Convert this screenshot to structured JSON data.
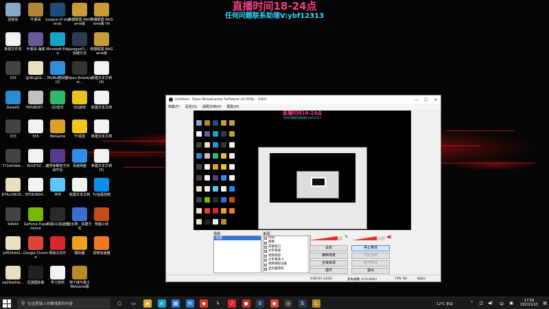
{
  "overlay": {
    "line1": "直播时间18-24点",
    "line2": "任何问题联系助理V:ybf12313"
  },
  "desktop_icons": [
    {
      "label": "回收站",
      "icon": "recycle-bin-icon",
      "color": "#8aa6c9"
    },
    {
      "label": "叶晨哥",
      "icon": "folder-icon",
      "color": "#b0863a"
    },
    {
      "label": "League of Legends",
      "icon": "league-of-legends-icon",
      "color": "#1f4d7a"
    },
    {
      "label": "英雄联盟 WeGame版",
      "icon": "lol-wegame-icon",
      "color": "#c99c3a"
    },
    {
      "label": "英雄联盟 WeGame版 (4)",
      "icon": "lol-wegame-icon",
      "color": "#c99c3a"
    },
    {
      "label": "新建文件夹",
      "icon": "file-icon",
      "color": "#f2f2f2"
    },
    {
      "label": "叶晨哥-海底",
      "icon": "folder-icon",
      "color": "#6a5a9a"
    },
    {
      "label": "Microsoft Edge",
      "icon": "edge-icon",
      "color": "#1aa3c9"
    },
    {
      "label": "LeagueCl... - 快捷方式",
      "icon": "league-client-icon",
      "color": "#2b3a55"
    },
    {
      "label": "英雄联盟 WeGame版",
      "icon": "lol-wegame-icon",
      "color": "#c99c3a"
    },
    {
      "label": "333",
      "icon": "app-icon",
      "color": "#444"
    },
    {
      "label": "@WL@GL...",
      "icon": "doc-icon",
      "color": "#e8e0c0"
    },
    {
      "label": "MuMu模拟器 (2)",
      "icon": "mumu-icon",
      "color": "#2f8fd8"
    },
    {
      "label": "Open Broadcast...",
      "icon": "obs-icon",
      "color": "#333"
    },
    {
      "label": "新建文本文档 (4)",
      "icon": "text-file-icon",
      "color": "#f2f2f2"
    },
    {
      "label": "DetailQ",
      "icon": "globe-icon",
      "color": "#2a8bd0"
    },
    {
      "label": "7N%BO97...",
      "icon": "file-icon",
      "color": "#c0c0c0"
    },
    {
      "label": "QQ音乐",
      "icon": "qq-music-icon",
      "color": "#2fb86b"
    },
    {
      "label": "QQ游戏",
      "icon": "qq-game-icon",
      "color": "#e9c31f"
    },
    {
      "label": "新建文本文档",
      "icon": "text-file-icon",
      "color": "#f2f2f2"
    },
    {
      "label": "333",
      "icon": "app-icon",
      "color": "#444"
    },
    {
      "label": "555",
      "icon": "file-icon",
      "color": "#f2f2f2"
    },
    {
      "label": "WeGame",
      "icon": "wegame-icon",
      "color": "#d9a227"
    },
    {
      "label": "YY语音",
      "icon": "yy-icon",
      "color": "#f4c51c"
    },
    {
      "label": "新建文本文档",
      "icon": "text-file-icon",
      "color": "#f2f2f2"
    },
    {
      "label": "771afcbbe...",
      "icon": "app-icon",
      "color": "#444"
    },
    {
      "label": "AUUFXZ...",
      "icon": "file-icon",
      "color": "#f2f2f2"
    },
    {
      "label": "魔界争霸官方对战平台",
      "icon": "game-platform-icon",
      "color": "#5a3a8a"
    },
    {
      "label": "百度网盘",
      "icon": "baidu-netdisk-icon",
      "color": "#2f8fe8"
    },
    {
      "label": "新建文本文档 (5)",
      "icon": "text-file-icon",
      "color": "#f2f2f2"
    },
    {
      "label": "874c29635...",
      "icon": "doc-icon",
      "color": "#e8e0c0"
    },
    {
      "label": "EFDE3604...",
      "icon": "file-icon",
      "color": "#f2f2f2"
    },
    {
      "label": "伴伴",
      "icon": "banban-icon",
      "color": "#5ac8fa"
    },
    {
      "label": "新建文本文档",
      "icon": "text-file-icon",
      "color": "#f2f2f2"
    },
    {
      "label": "TV远程控制",
      "icon": "teamviewer-icon",
      "color": "#0e8ee9"
    },
    {
      "label": "44444",
      "icon": "app-icon",
      "color": "#444"
    },
    {
      "label": "GeForce Experience",
      "icon": "geforce-icon",
      "color": "#76b900"
    },
    {
      "label": "网易UU加速器",
      "icon": "uu-icon",
      "color": "#2a2a2a"
    },
    {
      "label": "逆水寒 - 快捷方式",
      "icon": "game-icon",
      "color": "#3a6fd0"
    },
    {
      "label": "穿越火线",
      "icon": "crossfire-icon",
      "color": "#c44a1a"
    },
    {
      "label": "a3634dd2...",
      "icon": "doc-icon",
      "color": "#e8e0c0"
    },
    {
      "label": "Google Chrome",
      "icon": "chrome-icon",
      "color": "#db4437"
    },
    {
      "label": "网易云音乐",
      "icon": "netease-music-icon",
      "color": "#d8262a"
    },
    {
      "label": "模拟器",
      "icon": "emulator-icon",
      "color": "#f0a020"
    },
    {
      "label": "雷神加速器",
      "icon": "thunder-accelerator-icon",
      "color": "#f07a20"
    },
    {
      "label": "ea29aefde...",
      "icon": "doc-icon",
      "color": "#e8e0c0"
    },
    {
      "label": "迅游国际版",
      "icon": "xunyou-icon",
      "color": "#222"
    },
    {
      "label": "学习资料",
      "icon": "file-icon",
      "color": "#f2f2f2"
    },
    {
      "label": "地下城与勇士 WeGame版",
      "icon": "dnf-icon",
      "color": "#b58a2a"
    }
  ],
  "obs": {
    "title": "Untitled - Open Broadcaster Software v0.659b - 32bit",
    "menu": [
      "档案(F)",
      "设定(S)",
      "说明文档(H)",
      "帮助(H)"
    ],
    "preview_banner_1": "直播时间18-24点",
    "preview_banner_2": "任何问题联系助理V:ybf12313",
    "scenes_label": "场景:",
    "scene_selected": "场景",
    "sources_label": "来源:",
    "sources": [
      {
        "name": "时间",
        "checked": false
      },
      {
        "name": "图像",
        "checked": true
      },
      {
        "name": "获取窗口",
        "checked": false
      },
      {
        "name": "文字来源",
        "checked": true
      },
      {
        "name": "视频视窗",
        "checked": false
      },
      {
        "name": "文字来源 5",
        "checked": false
      },
      {
        "name": "视频捕捉设备",
        "checked": false
      },
      {
        "name": "显示器获取",
        "checked": true
      }
    ],
    "buttons": {
      "settings": "设定",
      "stop_stream": "停止推流",
      "edit_scene": "编辑场景",
      "start_record": "开始录制",
      "global_sources": "全域来源",
      "pause": "暂停推流",
      "plugins": "插件",
      "exit": "退出"
    },
    "audio": {
      "desktop_level": 0.85,
      "mic_level": 0.75
    },
    "status": {
      "time": "0:00:01 (LIVE)",
      "dropped": "丢失帧数: 0 (0.00%)",
      "fps": "FPS: 60",
      "bitrate": "0kb/s"
    }
  },
  "taskbar": {
    "search_placeholder": "在这里输入你要搜索的内容",
    "pinned": [
      {
        "icon": "cortana-icon",
        "color": "#1b1b1b",
        "glyph": "○",
        "active": false
      },
      {
        "icon": "task-view-icon",
        "color": "#1b1b1b",
        "glyph": "▭",
        "active": false
      },
      {
        "icon": "file-explorer-icon",
        "color": "#e0b030",
        "glyph": "▰",
        "active": false
      },
      {
        "icon": "edge-icon",
        "color": "#1aa3c9",
        "glyph": "e",
        "active": false
      },
      {
        "icon": "store-icon",
        "color": "#2a7bd8",
        "glyph": "▦",
        "active": false
      },
      {
        "icon": "mail-icon",
        "color": "#2a7bd8",
        "glyph": "✉",
        "active": false
      },
      {
        "icon": "app-red-icon",
        "color": "#d83a2a",
        "glyph": "◆",
        "active": false
      },
      {
        "icon": "lightning-icon",
        "color": "#1b1b1b",
        "glyph": "ϟ",
        "active": false
      },
      {
        "icon": "netease-music-icon",
        "color": "#d8262a",
        "glyph": "♪",
        "active": false
      },
      {
        "icon": "app-icon",
        "color": "#c83030",
        "glyph": "●",
        "active": false
      },
      {
        "icon": "steam-icon",
        "color": "#2a3a55",
        "glyph": "S",
        "active": false
      },
      {
        "icon": "chrome-icon",
        "color": "#db4437",
        "glyph": "◉",
        "active": true
      },
      {
        "icon": "obs-icon",
        "color": "#333",
        "glyph": "◎",
        "active": true
      },
      {
        "icon": "steam-icon",
        "color": "#2a3a55",
        "glyph": "S",
        "active": false
      },
      {
        "icon": "league-client-icon",
        "color": "#b58a2a",
        "glyph": "L",
        "active": false
      }
    ],
    "weather": "12°C 多云",
    "time": "17:59",
    "date": "2022/1/13"
  }
}
